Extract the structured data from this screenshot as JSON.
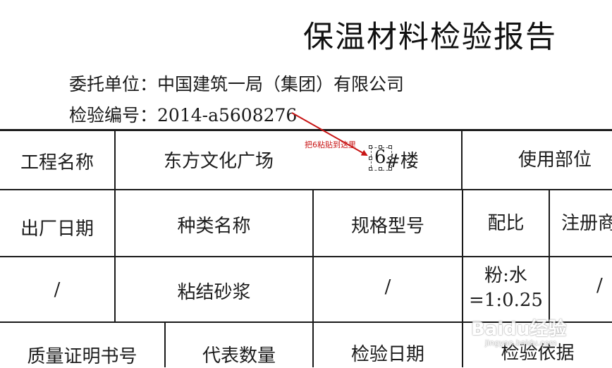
{
  "report": {
    "title": "保温材料检验报告",
    "client_label": "委托单位：",
    "client_value": "中国建筑一局（集团）有限公司",
    "number_label": "检验编号：",
    "number_value": "2014-a5608276"
  },
  "table": {
    "row1": {
      "project_name_label": "工程名称",
      "project_name_value": "东方文化广场",
      "building_number": "6",
      "building_suffix": "#楼",
      "usage_location_label": "使用部位"
    },
    "row2": {
      "factory_date_label": "出厂日期",
      "type_name_label": "种类名称",
      "spec_model_label": "规格型号",
      "ratio_label": "配比",
      "registered_label": "注册商"
    },
    "row3": {
      "factory_date_value": "/",
      "type_name_value": "粘结砂浆",
      "spec_model_value": "/",
      "ratio_value_line1": "粉:水",
      "ratio_value_line2": "=1:0.25",
      "registered_value": "/"
    },
    "row4": {
      "quality_cert_label": "质量证明书号",
      "quantity_label": "代表数量",
      "inspection_date_label": "检验日期",
      "inspection_basis_label": "检验依据"
    }
  },
  "annotation": {
    "text": "把6粘贴到这里",
    "color": "#c81414"
  },
  "watermark": {
    "brand": "Baidu经验",
    "url": "jingyan.baidu.com"
  }
}
